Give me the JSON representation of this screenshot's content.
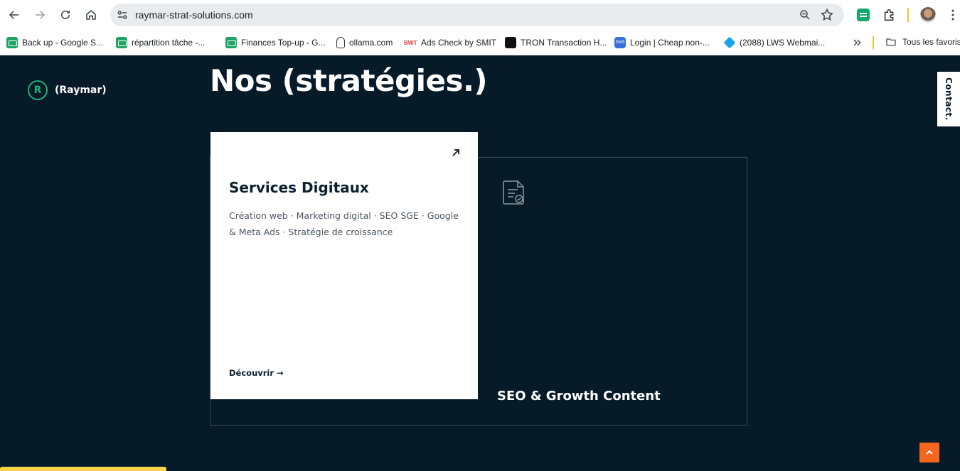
{
  "browser": {
    "url": "raymar-strat-solutions.com",
    "bookmarks": [
      {
        "label": "Back up - Google S...",
        "icon": "sheets-icon"
      },
      {
        "label": "répartition tâche -...",
        "icon": "sheets-icon"
      },
      {
        "label": "Finances Top-up - G...",
        "icon": "sheets-icon"
      },
      {
        "label": "ollama.com",
        "icon": "ollama-icon"
      },
      {
        "label": "Ads Check by SMIT",
        "icon": "smit-icon"
      },
      {
        "label": "TRON Transaction H...",
        "icon": "oklink-icon"
      },
      {
        "label": "Login | Cheap non-...",
        "icon": "sms-icon"
      },
      {
        "label": "(2088) LWS Webmai...",
        "icon": "lws-icon"
      }
    ],
    "all_bookmarks_label": "Tous les favoris",
    "smit_badge": "SMIT",
    "sms_badge": "SMS"
  },
  "site": {
    "logo_letter": "R",
    "brand": "(Raymar)",
    "heading": "Nos (stratégies.)",
    "contact_tab": "Contact.",
    "cards": {
      "primary": {
        "title": "Services Digitaux",
        "description": "Création web · Marketing digital · SEO SGE · Google & Meta Ads · Stratégie de croissance",
        "cta": "Découvrir →"
      },
      "secondary": {
        "title": "SEO & Growth Content",
        "icon": "document-check-icon"
      }
    }
  },
  "colors": {
    "background": "#071a28",
    "brand_green": "#1fae7a",
    "scroll_button": "#f3671e"
  }
}
